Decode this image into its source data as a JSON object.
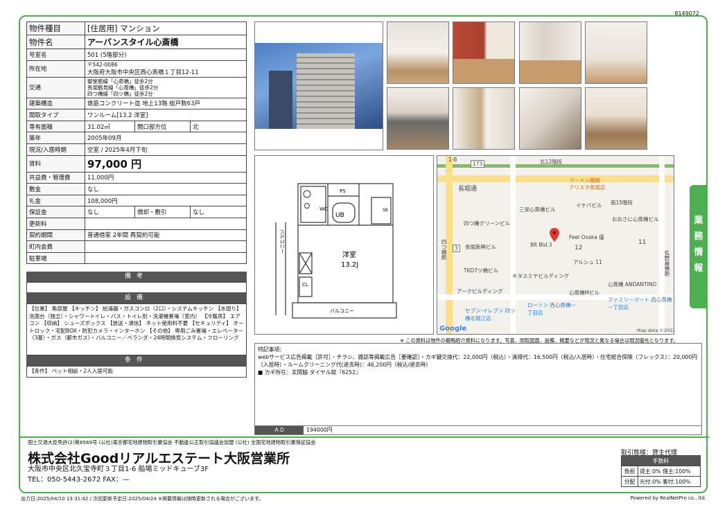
{
  "doc_id": "8149072",
  "rows": [
    {
      "label": "物件種目",
      "value": "[住居用] マンション"
    },
    {
      "label": "物件名",
      "value": "アーバンスタイル心斎橋"
    },
    {
      "label": "号室名",
      "value": "501 (5階部分)"
    },
    {
      "label": "所在地",
      "value_top": "〒542-0086",
      "value": "大阪府大阪市中央区西心斎橋１丁目12-11"
    },
    {
      "label": "交通",
      "lines": [
        "御堂筋線「心斎橋」徒歩2分",
        "長堀鶴見線「心斎橋」徒歩2分",
        "四つ橋線「四ツ橋」徒歩2分"
      ]
    },
    {
      "label": "建築構造",
      "value": "鉄筋コンクリート造 地上13階 総戸数63戸"
    },
    {
      "label": "間取タイプ",
      "value": "ワンルーム[13.2 洋室]"
    },
    {
      "label": "専有面積",
      "value": "31.02㎡",
      "extra_label": "開口部方位",
      "extra_value": "北"
    },
    {
      "label": "築年",
      "value": "2005年09月"
    },
    {
      "label": "現況/入居時期",
      "value": "空室 / 2025年4月下旬"
    },
    {
      "label": "賃料",
      "value": "97,000 円"
    },
    {
      "label": "共益費・管理費",
      "value": "11,000円"
    },
    {
      "label": "敷金",
      "value": "なし"
    },
    {
      "label": "礼金",
      "value": "108,000円"
    },
    {
      "label": "保証金",
      "value": "なし",
      "extra_label": "償却・敷引",
      "extra_value": "なし"
    },
    {
      "label": "更新料",
      "value": ""
    },
    {
      "label": "契約期間",
      "value": "普通借家 2年間 再契約可能"
    },
    {
      "label": "町内会費",
      "value": ""
    },
    {
      "label": "駐車場",
      "value": ""
    }
  ],
  "bikou_title": "備考",
  "setsubi_title": "設備",
  "setsubi_text": "【位置】 角部屋 【キッチン】 給湯器・ガスコンロ（2口）・システムキッチン 【水廻り】 洗面台（独立）・シャワートイレ・バス・トイレ別・洗濯機置場（室内） 【冷暖房】 エアコン 【収納】 シューズボックス 【放送・通信】 ネット使用料不要 【セキュリティ】 オートロック・宅配BOX・防犯カメラ・インターホン 【その他】 専用ごみ置場・エレベーター（3基）・ガス（都市ガス）・バルコニー／ベランダ・24時間換気システム・フローリング",
  "jouken_title": "条件",
  "jouken_text": "【条件】 ペット相談・2人入居可能",
  "floorplan": {
    "room_label": "洋室",
    "room_size": "13.2J",
    "balcony": "バルコニー",
    "ub": "UB",
    "wc": "WC",
    "ps": "PS",
    "sb": "SB",
    "cl": "CL",
    "left_balcony": "バルコニー"
  },
  "map": {
    "labels": [
      "1-B",
      "北12階段",
      "長堀通",
      "ラーメン横綱",
      "クリスタ長堀店",
      "イナバビル",
      "南15階段",
      "三栄心斎橋ビル",
      "四つ橋グリーンビル",
      "おおさに心斎橋ビル",
      "長堀新興ビル",
      "Feel Osaka 優",
      "8R Bld.3",
      "12",
      "11",
      "アルシュ 11",
      "TKD7ツ橋ビル",
      "キタスミヤビルディング",
      "心斎橋 ANDANTINO",
      "アークビルディング",
      "心斎橋Mビル",
      "ファミリーマート 西心斎橋一丁目店",
      "セブン-イレブン 四ツ橋北堀江店",
      "ローソン 西心斎橋一丁目店",
      "四つ橋筋",
      "佐野屋橋筋",
      "Google",
      "Map data ©2023",
      "173",
      "3"
    ]
  },
  "note": "※ この資料は物件の概略紹介資料になります。写真、間取図面、設備、概要などが現況と異なる場合は現況優先となります。",
  "remarks": {
    "title": "特記事項：",
    "line1": "webサービス広告掲載［許可］・チラシ、雑誌等掲載広告［要確認］・カギ鍵交換代：22,000円（税込）・清掃代：16,500円（税込/入居時）・住宅総合保険（フレックス）：20,000円（入居時）・ルームクリーニング代(退去時)：46,200円（税込/退去時）",
    "line2": "■ カギ所在：玄関脇 ダイヤル錠『6252』"
  },
  "ad": {
    "label": "ＡＤ",
    "value": "194000円"
  },
  "side_tab": [
    "業",
    "務",
    "情",
    "報"
  ],
  "footer": {
    "assoc": "国土交通大臣免許(2)第8569号 (公社)東京都宅地建物取引業協会 不動産公正取引協議会加盟 (公社) 全国宅地建物取引業保証協会",
    "company": "株式会社Goodリアルエステート大阪営業所",
    "address": "大阪市中央区北久宝寺町３丁目1-6 船場ミッドキューブ3F",
    "tel": "TEL：050-5443-2672 FAX：—",
    "deal": "取引態様：貸主代理",
    "fee_title": "手数料",
    "fee_rows": [
      {
        "k": "負担",
        "v": "貸主:0% 借主:100%"
      },
      {
        "k": "分配",
        "v": "元付:0% 客付:100%"
      }
    ],
    "output": "出力日:2025/04/10 13:31:42 / 次回更新予定日:2025/04/24 ※掲載情報は随時更新される場合がございます。",
    "powered": "Powered by RealNetPro co., ltd."
  }
}
